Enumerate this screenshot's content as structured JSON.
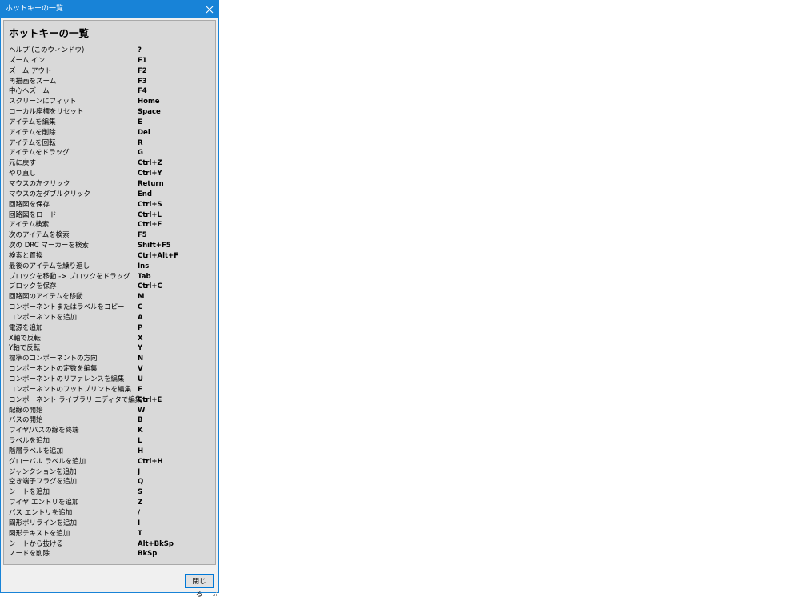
{
  "window": {
    "title": "ホットキーの一覧",
    "close_icon": "close-icon"
  },
  "content": {
    "heading": "ホットキーの一覧",
    "hotkeys": [
      {
        "action": "ヘルプ (このウィンドウ)",
        "key": "?"
      },
      {
        "action": "ズーム イン",
        "key": "F1"
      },
      {
        "action": "ズーム アウト",
        "key": "F2"
      },
      {
        "action": "再描画をズーム",
        "key": "F3"
      },
      {
        "action": "中心へズーム",
        "key": "F4"
      },
      {
        "action": "スクリーンにフィット",
        "key": "Home"
      },
      {
        "action": "ローカル座標をリセット",
        "key": "Space"
      },
      {
        "action": "アイテムを編集",
        "key": "E"
      },
      {
        "action": "アイテムを削除",
        "key": "Del"
      },
      {
        "action": "アイテムを回転",
        "key": "R"
      },
      {
        "action": "アイテムをドラッグ",
        "key": "G"
      },
      {
        "action": "元に戻す",
        "key": "Ctrl+Z"
      },
      {
        "action": "やり直し",
        "key": "Ctrl+Y"
      },
      {
        "action": "マウスの左クリック",
        "key": "Return"
      },
      {
        "action": "マウスの左ダブルクリック",
        "key": "End"
      },
      {
        "action": "回路図を保存",
        "key": "Ctrl+S"
      },
      {
        "action": "回路図をロード",
        "key": "Ctrl+L"
      },
      {
        "action": "アイテム検索",
        "key": "Ctrl+F"
      },
      {
        "action": "次のアイテムを検索",
        "key": "F5"
      },
      {
        "action": "次の DRC マーカーを検索",
        "key": "Shift+F5"
      },
      {
        "action": "検索と置換",
        "key": "Ctrl+Alt+F"
      },
      {
        "action": "最後のアイテムを繰り返し",
        "key": "Ins"
      },
      {
        "action": "ブロックを移動 -> ブロックをドラッグ",
        "key": "Tab"
      },
      {
        "action": "ブロックを保存",
        "key": "Ctrl+C"
      },
      {
        "action": "回路図のアイテムを移動",
        "key": "M"
      },
      {
        "action": "コンポーネントまたはラベルをコピー",
        "key": "C"
      },
      {
        "action": "コンポーネントを追加",
        "key": "A"
      },
      {
        "action": "電源を追加",
        "key": "P"
      },
      {
        "action": "X軸で反転",
        "key": "X"
      },
      {
        "action": "Y軸で反転",
        "key": "Y"
      },
      {
        "action": "標準のコンポーネントの方向",
        "key": "N"
      },
      {
        "action": "コンポーネントの定数を編集",
        "key": "V"
      },
      {
        "action": "コンポーネントのリファレンスを編集",
        "key": "U"
      },
      {
        "action": "コンポーネントのフットプリントを編集",
        "key": "F"
      },
      {
        "action": "コンポーネント ライブラリ エディタで編集",
        "key": "Ctrl+E"
      },
      {
        "action": "配線の開始",
        "key": "W"
      },
      {
        "action": "バスの開始",
        "key": "B"
      },
      {
        "action": "ワイヤ/バスの線を終端",
        "key": "K"
      },
      {
        "action": "ラベルを追加",
        "key": "L"
      },
      {
        "action": "階層ラベルを追加",
        "key": "H"
      },
      {
        "action": "グローバル ラベルを追加",
        "key": "Ctrl+H"
      },
      {
        "action": "ジャンクションを追加",
        "key": "J"
      },
      {
        "action": "空き端子フラグを追加",
        "key": "Q"
      },
      {
        "action": "シートを追加",
        "key": "S"
      },
      {
        "action": "ワイヤ エントリを追加",
        "key": "Z"
      },
      {
        "action": "バス エントリを追加",
        "key": "/"
      },
      {
        "action": "図形ポリラインを追加",
        "key": "I"
      },
      {
        "action": "図形テキストを追加",
        "key": "T"
      },
      {
        "action": "シートから抜ける",
        "key": "Alt+BkSp"
      },
      {
        "action": "ノードを削除",
        "key": "BkSp"
      }
    ]
  },
  "footer": {
    "close_label": "閉じる"
  },
  "colors": {
    "titlebar": "#1883d7",
    "panel": "#d9d9d9",
    "dialog": "#f0f0f0"
  }
}
